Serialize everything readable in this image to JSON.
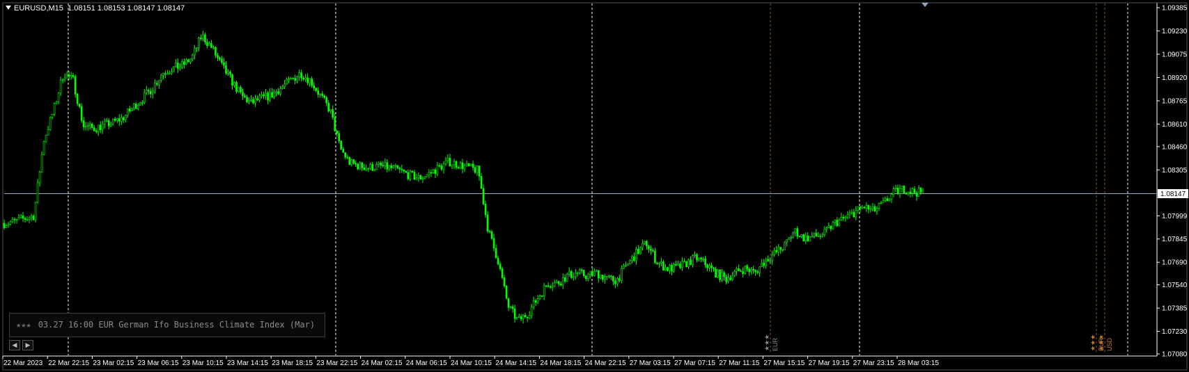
{
  "header": {
    "symbol": "EURUSD,M15",
    "ohlc": "1.08151 1.08153 1.08147 1.08147"
  },
  "current_price_label": "1.08147",
  "news": {
    "stars": "★★★",
    "text": "03.27 16:00 EUR German Ifo Business Climate Index (Mar)"
  },
  "nav": {
    "prev": "◀",
    "next": "▶"
  },
  "events": [
    {
      "stars": "★★★",
      "currency": "EUR"
    },
    {
      "stars": "★★★",
      "currency": "EUR"
    },
    {
      "stars": "★★★",
      "currency": "USD"
    }
  ],
  "colors": {
    "background": "#000000",
    "candles": "#00ff00",
    "price_line": "#8fa6c1",
    "grid_vertical": "#ffffff",
    "event_line": "#8a5a2a",
    "axis": "#ffffff"
  },
  "chart_data": {
    "type": "line",
    "title": "EURUSD,M15",
    "ylim": [
      1.0708,
      1.09385
    ],
    "y_ticks": [
      "1.09385",
      "1.09230",
      "1.09075",
      "1.08920",
      "1.08765",
      "1.08610",
      "1.08460",
      "1.08305",
      "1.08147",
      "1.07999",
      "1.07845",
      "1.07690",
      "1.07540",
      "1.07385",
      "1.07230",
      "1.07080"
    ],
    "x_ticks": [
      "22 Mar 2023",
      "22 Mar 22:15",
      "23 Mar 02:15",
      "23 Mar 06:15",
      "23 Mar 10:15",
      "23 Mar 14:15",
      "23 Mar 18:15",
      "23 Mar 22:15",
      "24 Mar 02:15",
      "24 Mar 06:15",
      "24 Mar 10:15",
      "24 Mar 14:15",
      "24 Mar 18:15",
      "24 Mar 22:15",
      "27 Mar 03:15",
      "27 Mar 07:15",
      "27 Mar 11:15",
      "27 Mar 15:15",
      "27 Mar 19:15",
      "27 Mar 23:15",
      "28 Mar 03:15"
    ],
    "grid": "vertical day separators",
    "series": [
      {
        "values": [
          1.0795,
          1.0796,
          1.0798,
          1.08,
          1.085,
          1.087,
          1.0895,
          1.089,
          1.086,
          1.0858,
          1.086,
          1.0862,
          1.0865,
          1.0872,
          1.0878,
          1.0885,
          1.0895,
          1.0898,
          1.09,
          1.0905,
          1.092,
          1.0912,
          1.09,
          1.089,
          1.088,
          1.0875,
          1.0878,
          1.088,
          1.0885,
          1.089,
          1.0895,
          1.089,
          1.088,
          1.087,
          1.0845,
          1.0835,
          1.0833,
          1.0832,
          1.0833,
          1.0832,
          1.083,
          1.0827,
          1.0825,
          1.0828,
          1.0832,
          1.0836,
          1.0834,
          1.0832,
          1.083,
          1.079,
          1.077,
          1.074,
          1.073,
          1.0735,
          1.0745,
          1.0755,
          1.0755,
          1.076,
          1.0762,
          1.076,
          1.0762,
          1.0758,
          1.0757,
          1.0767,
          1.0775,
          1.0782,
          1.077,
          1.0765,
          1.0765,
          1.0768,
          1.0772,
          1.0768,
          1.0762,
          1.0758,
          1.0762,
          1.0765,
          1.0762,
          1.077,
          1.0775,
          1.078,
          1.079,
          1.0785,
          1.0786,
          1.0788,
          1.0795,
          1.0798,
          1.0802,
          1.0806,
          1.0803,
          1.0808,
          1.0815,
          1.0818,
          1.0816,
          1.0815
        ]
      }
    ]
  }
}
